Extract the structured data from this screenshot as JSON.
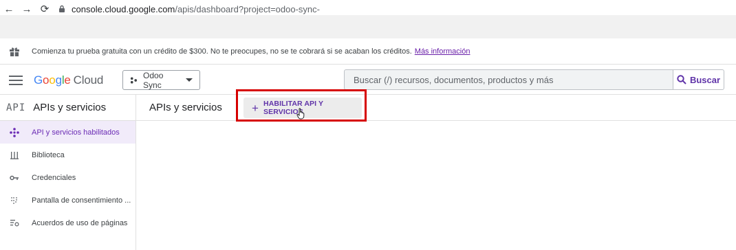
{
  "browser": {
    "back": "←",
    "forward": "→",
    "reload": "⟳",
    "url_host": "console.cloud.google.com",
    "url_path": "/apis/dashboard?project=odoo-sync-"
  },
  "promo": {
    "text": "Comienza tu prueba gratuita con un crédito de $300. No te preocupes, no se te cobrará si se acaban los créditos.",
    "link": "Más información"
  },
  "header": {
    "logo_letters": [
      "G",
      "o",
      "o",
      "g",
      "l",
      "e"
    ],
    "logo_cloud": "Cloud",
    "project": "Odoo Sync",
    "search_placeholder": "Buscar (/) recursos, documentos, productos y más",
    "search_button": "Buscar"
  },
  "sidebar": {
    "badge": "API",
    "title": "APIs y servicios",
    "items": [
      {
        "label": "API y servicios habilitados",
        "icon": "diamond-arrows-icon",
        "active": true
      },
      {
        "label": "Biblioteca",
        "icon": "library-icon",
        "active": false
      },
      {
        "label": "Credenciales",
        "icon": "key-icon",
        "active": false
      },
      {
        "label": "Pantalla de consentimiento ...",
        "icon": "consent-dots-icon",
        "active": false
      },
      {
        "label": "Acuerdos de uso de páginas",
        "icon": "settings-list-icon",
        "active": false
      }
    ]
  },
  "main": {
    "title": "APIs y servicios",
    "enable_button": "HABILITAR API Y SERVICIOS"
  },
  "colors": {
    "accent": "#5f33a8",
    "active_bg": "#f1ebfa",
    "highlight": "#d60000"
  }
}
